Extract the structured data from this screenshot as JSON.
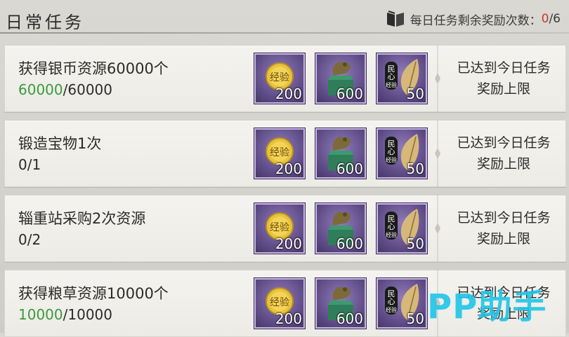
{
  "header": {
    "title": "日常任务",
    "quota_label": "每日任务剩余奖励次数：",
    "quota_current": "0",
    "quota_total": "/6"
  },
  "tasks": [
    {
      "name": "获得银币资源60000个",
      "progress_done": "60000",
      "progress_rest": "/60000",
      "rewards": [
        {
          "icon": "experience-coin-icon",
          "amount": "200"
        },
        {
          "icon": "dragon-seal-icon",
          "amount": "600"
        },
        {
          "icon": "popular-support-feather-icon",
          "amount": "50"
        }
      ],
      "status_line1": "已达到今日任务",
      "status_line2": "奖励上限"
    },
    {
      "name": "锻造宝物1次",
      "progress_done": "",
      "progress_rest": "0/1",
      "rewards": [
        {
          "icon": "experience-coin-icon",
          "amount": "200"
        },
        {
          "icon": "dragon-seal-icon",
          "amount": "600"
        },
        {
          "icon": "popular-support-feather-icon",
          "amount": "50"
        }
      ],
      "status_line1": "已达到今日任务",
      "status_line2": "奖励上限"
    },
    {
      "name": "辎重站采购2次资源",
      "progress_done": "",
      "progress_rest": "0/2",
      "rewards": [
        {
          "icon": "experience-coin-icon",
          "amount": "200"
        },
        {
          "icon": "dragon-seal-icon",
          "amount": "600"
        },
        {
          "icon": "popular-support-feather-icon",
          "amount": "50"
        }
      ],
      "status_line1": "已达到今日任务",
      "status_line2": "奖励上限"
    },
    {
      "name": "获得粮草资源10000个",
      "progress_done": "10000",
      "progress_rest": "/10000",
      "rewards": [
        {
          "icon": "experience-coin-icon",
          "amount": "200"
        },
        {
          "icon": "dragon-seal-icon",
          "amount": "600"
        },
        {
          "icon": "popular-support-feather-icon",
          "amount": "50"
        }
      ],
      "status_line1": "已达到今日任务",
      "status_line2": "奖励上限"
    }
  ],
  "icon_text": {
    "coin": "经验",
    "support_1": "民",
    "support_2": "心",
    "support_3": "经验"
  },
  "watermark": "PP助手",
  "colors": {
    "progress_done": "#3b9a3b",
    "quota_current": "#c33a2a",
    "reward_bg": "#5e4b86",
    "watermark": "#1ec6e8"
  }
}
